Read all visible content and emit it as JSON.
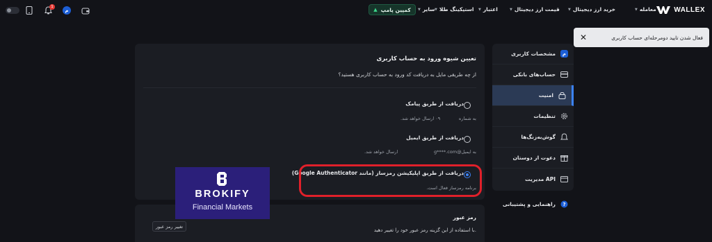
{
  "header": {
    "brand": "WALLEX",
    "nav": [
      {
        "label": "معامله"
      },
      {
        "label": "خرید ارز دیجیتال"
      },
      {
        "label": "قیمت ارز دیجیتال"
      },
      {
        "label": "اعتبار"
      },
      {
        "label": "استیکینگ طلا"
      },
      {
        "label": "سایر"
      }
    ],
    "campaign": "کمپین پامپ",
    "avatar_initial": "م",
    "notification_count": "1"
  },
  "toast": {
    "message": "فعال شدن تایید دومرحله‌ای حساب کاربری"
  },
  "sidebar": {
    "items": [
      {
        "label": "مشخصات کاربری",
        "icon": "user-profile-icon"
      },
      {
        "label": "حساب‌های بانکی",
        "icon": "bank-card-icon"
      },
      {
        "label": "امنیت",
        "icon": "lock-icon",
        "active": true
      },
      {
        "label": "تنظیمات",
        "icon": "gear-icon"
      },
      {
        "label": "گوش‌به‌زنگ‌ها",
        "icon": "bell-icon"
      },
      {
        "label": "دعوت از دوستان",
        "icon": "gift-icon"
      },
      {
        "label": "مدیریت API",
        "icon": "api-icon"
      }
    ],
    "support": "راهنمایی و پشتیبانی"
  },
  "login_method": {
    "title": "تعیین شیوه ورود به حساب کاربری",
    "question": "از چه طریقی مایل به دریافت کد ورود به حساب کاربری هستید؟",
    "options": [
      {
        "label": "دریافت از طریق پیامک",
        "hint_left": "۰۹ ارسال خواهد شد.",
        "hint_right": "به شماره",
        "selected": false
      },
      {
        "label": "دریافت از طریق ایمیل",
        "hint_left": "ارسال خواهد شد.",
        "hint_mid": "@g****.com",
        "hint_right": "به ایمیل",
        "selected": false
      },
      {
        "label": "دریافت از طریق اپلیکیشن رمزساز (مانند Google Authenticator)",
        "hint": "برنامه رمزساز فعال است.",
        "selected": true
      }
    ]
  },
  "password": {
    "title": "رمز عبور",
    "description": "با استفاده از این گزینه رمز عبور خود را تغییر دهید.",
    "button": "تغییر رمز عبور"
  },
  "watermark": {
    "name": "BROKIFY",
    "tagline": "Financial Markets"
  },
  "colors": {
    "background": "#121318",
    "card": "#1b1d23",
    "accent": "#3b82f6",
    "highlight": "#e0202a",
    "campaign": "#16352a"
  }
}
